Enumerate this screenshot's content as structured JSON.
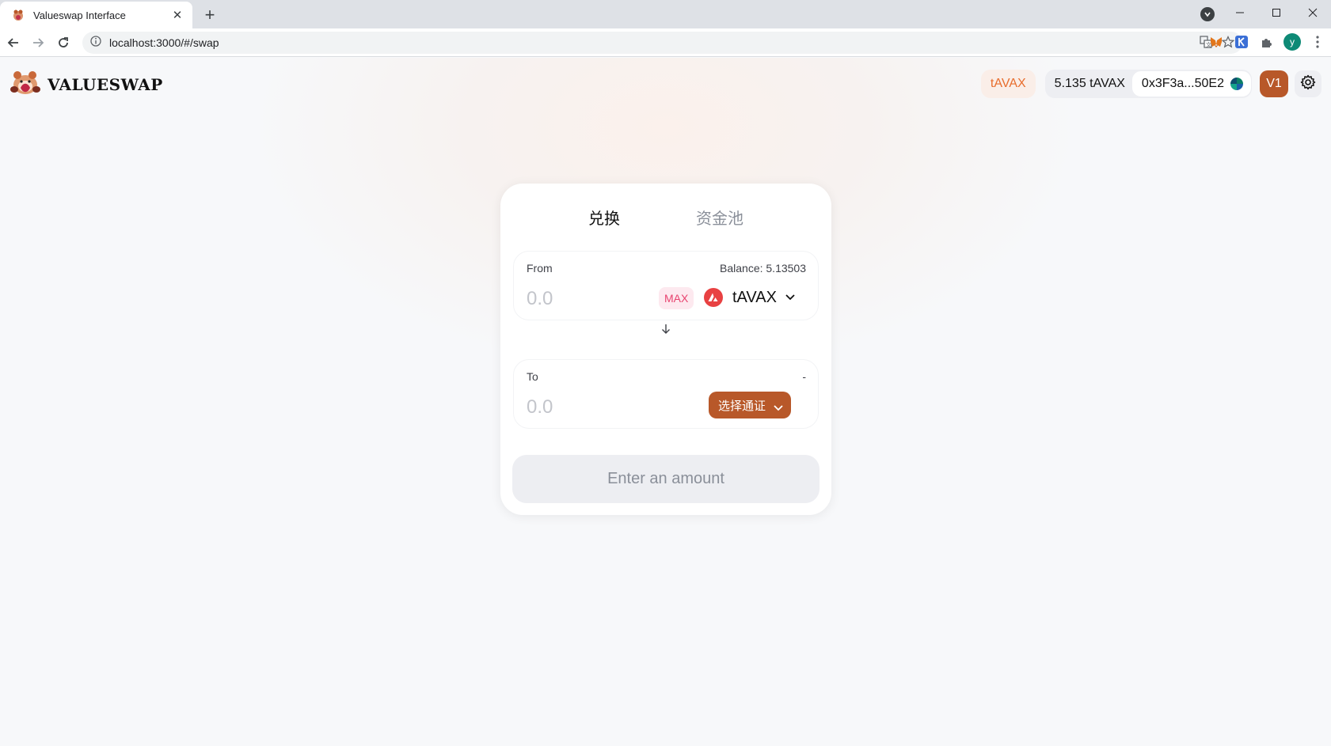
{
  "browser": {
    "tab_title": "Valueswap Interface",
    "tab_close": "✕",
    "new_tab": "+",
    "url": "localhost:3000/#/swap",
    "profile_initial": "y"
  },
  "header": {
    "logo_text": "VALUESWAP",
    "network": "tAVAX",
    "balance": "5.135 tAVAX",
    "address": "0x3F3a...50E2",
    "version": "V1"
  },
  "swap": {
    "tabs": [
      "兑换",
      "资金池"
    ],
    "from": {
      "label": "From",
      "balance": "Balance: 5.13503",
      "placeholder": "0.0",
      "max_label": "MAX",
      "token": "tAVAX"
    },
    "to": {
      "label": "To",
      "balance": "-",
      "placeholder": "0.0",
      "select_label": "选择通证"
    },
    "submit_label": "Enter an amount"
  },
  "colors": {
    "accent": "#b85829",
    "network_text": "#e86d2d",
    "max_text": "#e8436f",
    "avax_red": "#e84142"
  },
  "icons": [
    "favicon-icon",
    "close-icon",
    "back-arrow-icon",
    "forward-arrow-icon",
    "reload-icon",
    "info-icon",
    "translate-icon",
    "star-icon",
    "metamask-icon",
    "k-extension-icon",
    "puzzle-icon",
    "menu-dots-icon",
    "gear-icon",
    "avax-icon",
    "chevron-down-icon",
    "arrow-down-icon"
  ]
}
